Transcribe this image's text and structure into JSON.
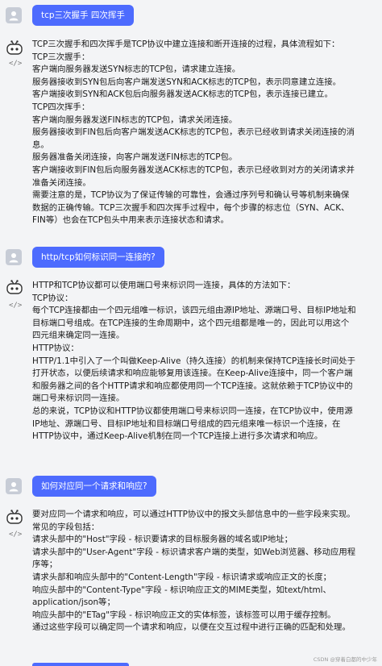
{
  "messages": [
    {
      "question": "tcp三次握手 四次挥手",
      "answer_lines": [
        "TCP三次握手和四次挥手是TCP协议中建立连接和断开连接的过程，具体流程如下：",
        "TCP三次握手：",
        "客户端向服务器发送SYN标志的TCP包，请求建立连接。",
        "服务器接收到SYN包后向客户端发送SYN和ACK标志的TCP包，表示同意建立连接。",
        "客户端接收到SYN和ACK包后向服务器发送ACK标志的TCP包，表示连接已建立。",
        "TCP四次挥手：",
        "客户端向服务器发送FIN标志的TCP包，请求关闭连接。",
        "服务器接收到FIN包后向客户端发送ACK标志的TCP包，表示已经收到请求关闭连接的消息。",
        "服务器准备关闭连接，向客户端发送FIN标志的TCP包。",
        "客户端接收到FIN包后向服务器发送ACK标志的TCP包，表示已经收到对方的关闭请求并准备关闭连接。",
        "需要注意的是，TCP协议为了保证传输的可靠性，会通过序列号和确认号等机制来确保数据的正确传输。TCP三次握手和四次挥手过程中，每个步骤的标志位（SYN、ACK、FIN等）也会在TCP包头中用来表示连接状态和请求。"
      ]
    },
    {
      "question": "http/tcp如何标识同一连接的?",
      "answer_lines": [
        "HTTP和TCP协议都可以使用端口号来标识同一连接，具体的方法如下：",
        "TCP协议：",
        "每个TCP连接都由一个四元组唯一标识，该四元组由源IP地址、源端口号、目标IP地址和目标端口号组成。在TCP连接的生命周期中，这个四元组都是唯一的，因此可以用这个四元组来确定同一连接。",
        "HTTP协议：",
        "HTTP/1.1中引入了一个叫做Keep-Alive（持久连接）的机制来保持TCP连接长时间处于打开状态，以便后续请求和响应能够复用该连接。在Keep-Alive连接中，同一个客户端和服务器之间的各个HTTP请求和响应都使用同一个TCP连接。这就依赖于TCP协议中的端口号来标识同一连接。",
        "总的来说，TCP协议和HTTP协议都使用端口号来标识同一连接，在TCP协议中，使用源IP地址、源端口号、目标IP地址和目标端口号组成的四元组来唯一标识一个连接，在HTTP协议中，通过Keep-Alive机制在同一个TCP连接上进行多次请求和响应。"
      ]
    },
    {
      "question": "如何对应同一个请求和响应?",
      "answer_lines": [
        "要对应同一个请求和响应，可以通过HTTP协议中的报文头部信息中的一些字段来实现。常见的字段包括：",
        "请求头部中的\"Host\"字段 - 标识要请求的目标服务器的域名或IP地址；",
        "请求头部中的\"User-Agent\"字段 - 标识请求客户端的类型，如Web浏览器、移动应用程序等；",
        "请求头部和响应头部中的\"Content-Length\"字段 - 标识请求或响应正文的长度；",
        "响应头部中的\"Content-Type\"字段 - 标识响应正文的MIME类型，如text/html、application/json等；",
        "响应头部中的\"ETag\"字段 - 标识响应正文的实体标签，该标签可以用于缓存控制。",
        "通过这些字段可以确定同一个请求和响应，以便在交互过程中进行正确的匹配和处理。"
      ]
    }
  ],
  "code_icon_glyph": "</>",
  "watermark": "CSDN @穿着白都的中少年",
  "colors": {
    "accent": "#4d6bfe",
    "background": "#f3f4f6"
  }
}
